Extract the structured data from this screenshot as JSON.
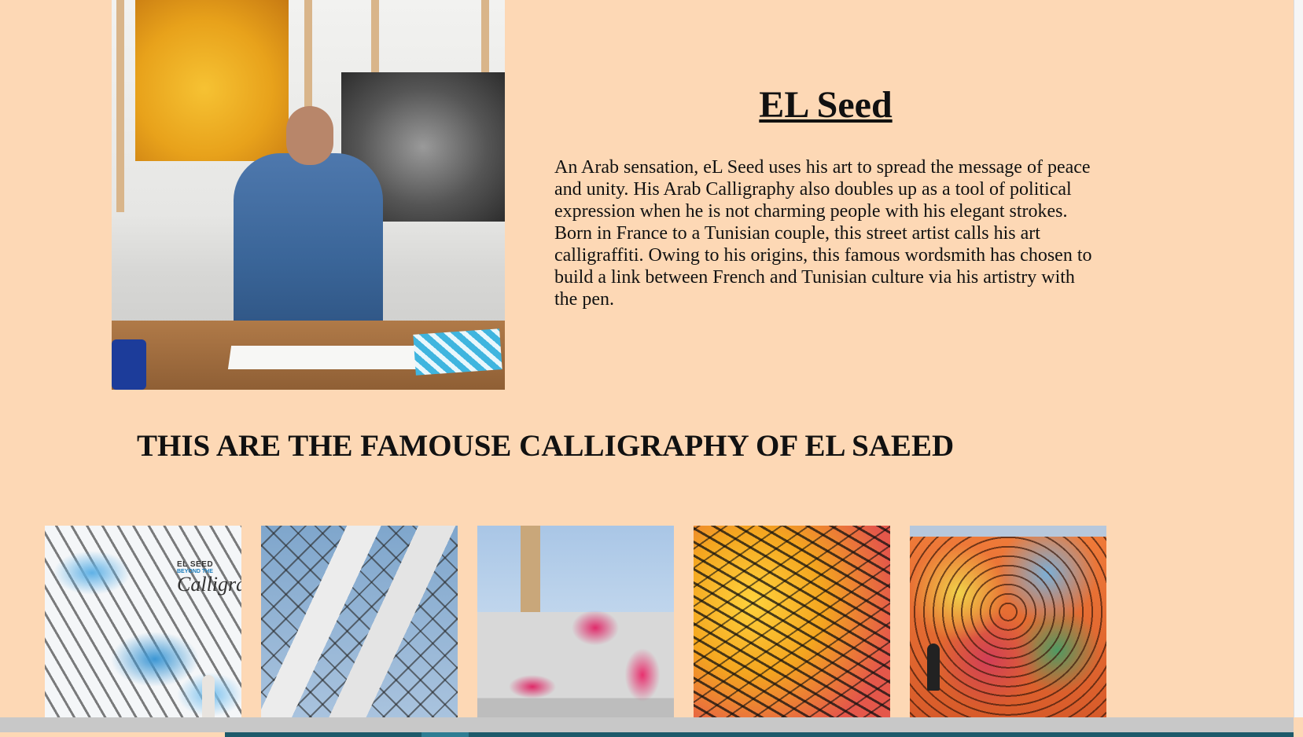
{
  "artist": {
    "name": "EL Seed",
    "bio": "An Arab sensation, eL Seed uses his art to spread the message of peace and unity. His Arab Calligraphy also doubles up as a tool of political expression when he is not charming people with his elegant strokes. Born in France to a Tunisian couple, this street artist calls his art calligraffiti. Owing to his origins, this famous wordsmith has chosen to build a link between French and Tunisian culture via his artistry with the pen."
  },
  "section": {
    "title": "THIS ARE THE FAMOUSE CALLIGRAPHY OF EL SAEED"
  },
  "gallery": {
    "thumb1_caption": {
      "line1": "EL SEED",
      "line2": "BEYOND THE",
      "line3": "Calligraphy"
    }
  }
}
